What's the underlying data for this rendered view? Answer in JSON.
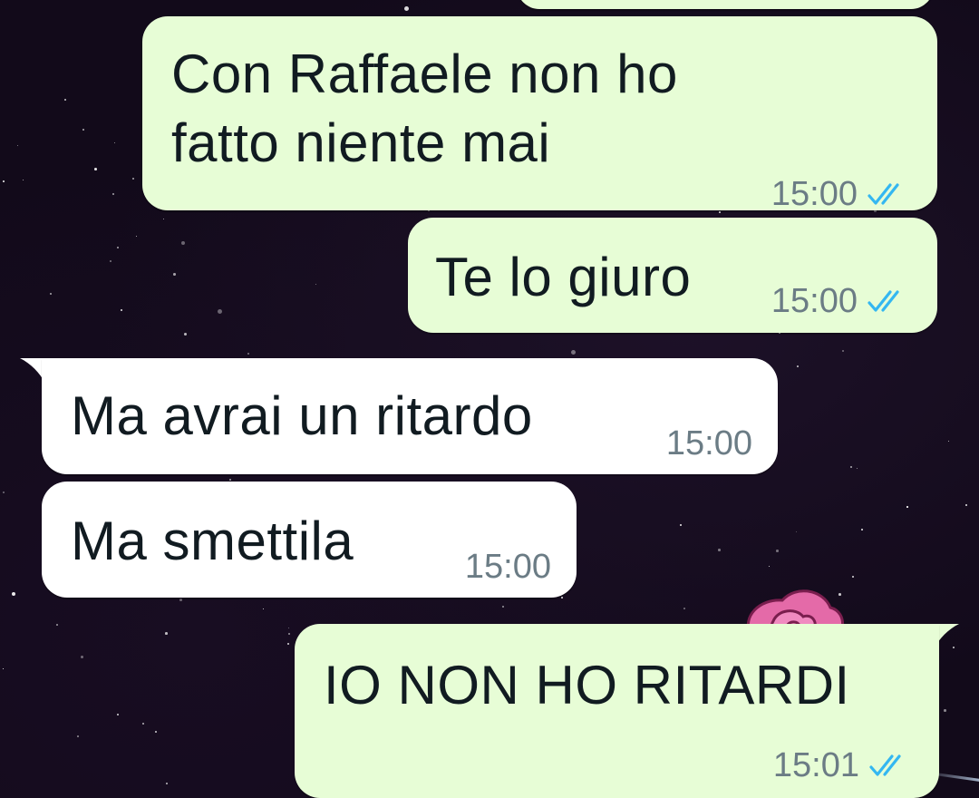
{
  "chat": {
    "messages": [
      {
        "direction": "outgoing",
        "text": "Con Raffaele non ho\nfatto niente mai",
        "time": "15:00",
        "status_icon": "double-check-read-icon"
      },
      {
        "direction": "outgoing",
        "text": "Te lo giuro",
        "time": "15:00",
        "status_icon": "double-check-read-icon"
      },
      {
        "direction": "incoming",
        "text": "Ma avrai un ritardo",
        "time": "15:00"
      },
      {
        "direction": "incoming",
        "text": "Ma smettila",
        "time": "15:00"
      },
      {
        "direction": "outgoing",
        "text": "IO NON HO RITARDI",
        "time": "15:01",
        "status_icon": "double-check-read-icon"
      }
    ]
  },
  "colors": {
    "outgoing_bubble": "#e7fdd6",
    "incoming_bubble": "#ffffff",
    "read_ticks": "#34b7f1",
    "timestamp": "#6b7c85",
    "wallpaper": "#120a1a"
  }
}
